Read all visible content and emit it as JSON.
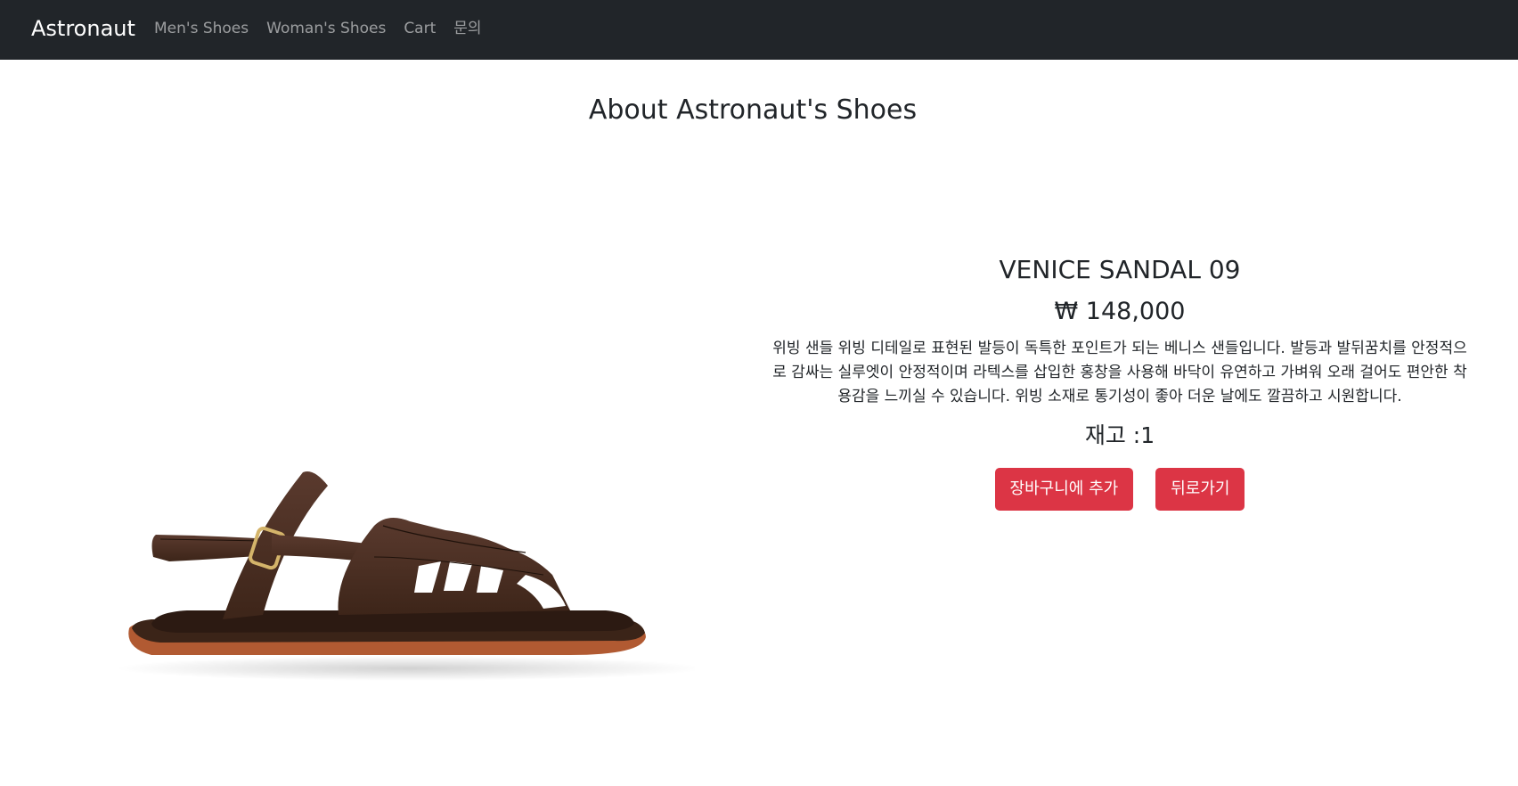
{
  "navbar": {
    "brand": "Astronaut",
    "links": [
      "Men's Shoes",
      "Woman's Shoes",
      "Cart",
      "문의"
    ]
  },
  "page": {
    "title": "About Astronaut's Shoes"
  },
  "product": {
    "name": "VENICE SANDAL 09",
    "price": "₩ 148,000",
    "description": "위빙 샌들 위빙 디테일로 표현된 발등이 독특한 포인트가 되는 베니스 샌들입니다. 발등과 발뒤꿈치를 안정적으로 감싸는 실루엣이 안정적이며 라텍스를 삽입한 홍창을 사용해 바닥이 유연하고 가벼워 오래 걸어도 편안한 착용감을 느끼실 수 있습니다. 위빙 소재로 통기성이 좋아 더운 날에도 깔끔하고 시원합니다.",
    "stock": "재고 :1",
    "image_icon": "sandal-image"
  },
  "actions": {
    "add_to_cart": "장바구니에 추가",
    "back": "뒤로가기"
  },
  "colors": {
    "navbar": "#212529",
    "button": "#dc3545"
  }
}
